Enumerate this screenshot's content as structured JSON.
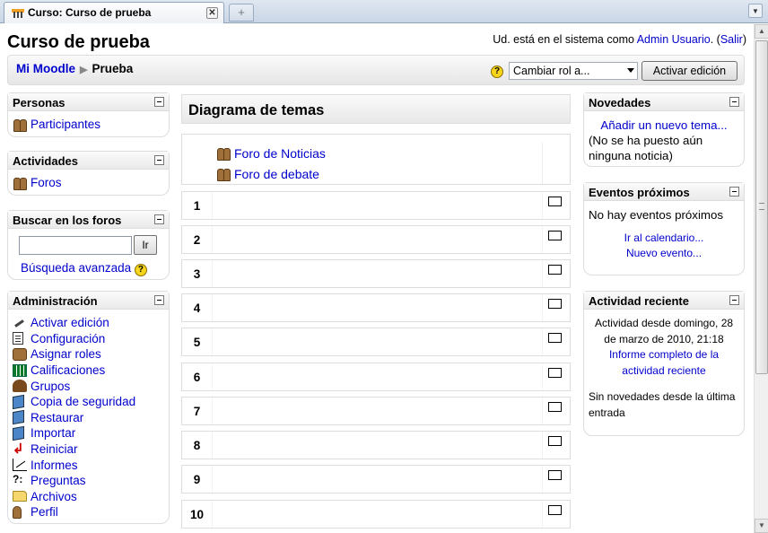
{
  "browser": {
    "tab_title": "Curso: Curso de prueba"
  },
  "header": {
    "title": "Curso de prueba",
    "login_prefix": "Ud. está en el sistema como ",
    "login_user": "Admin Usuario",
    "login_sep": ". (",
    "logout": "Salir",
    "login_end": ")"
  },
  "navbar": {
    "home": "Mi Moodle",
    "current": "Prueba",
    "role_select": "Cambiar rol a...",
    "edit_button": "Activar edición"
  },
  "left": {
    "personas": {
      "title": "Personas",
      "items": [
        "Participantes"
      ]
    },
    "actividades": {
      "title": "Actividades",
      "items": [
        "Foros"
      ]
    },
    "buscar": {
      "title": "Buscar en los foros",
      "button": "Ir",
      "advanced": "Búsqueda avanzada"
    },
    "admin": {
      "title": "Administración",
      "items": [
        "Activar edición",
        "Configuración",
        "Asignar roles",
        "Calificaciones",
        "Grupos",
        "Copia de seguridad",
        "Restaurar",
        "Importar",
        "Reiniciar",
        "Informes",
        "Preguntas",
        "Archivos",
        "Perfil"
      ]
    }
  },
  "center": {
    "title": "Diagrama de temas",
    "section0": [
      "Foro de Noticias",
      "Foro de debate"
    ],
    "topics": [
      "1",
      "2",
      "3",
      "4",
      "5",
      "6",
      "7",
      "8",
      "9",
      "10"
    ]
  },
  "right": {
    "novedades": {
      "title": "Novedades",
      "add_link": "Añadir un nuevo tema...",
      "empty": "(No se ha puesto aún ninguna noticia)"
    },
    "eventos": {
      "title": "Eventos próximos",
      "empty": "No hay eventos próximos",
      "calendar": "Ir al calendario...",
      "new_event": "Nuevo evento..."
    },
    "actividad": {
      "title": "Actividad reciente",
      "since": "Actividad desde domingo, 28 de marzo de 2010, 21:18",
      "report": "Informe completo de la actividad reciente",
      "none": "Sin novedades desde la última entrada"
    }
  }
}
